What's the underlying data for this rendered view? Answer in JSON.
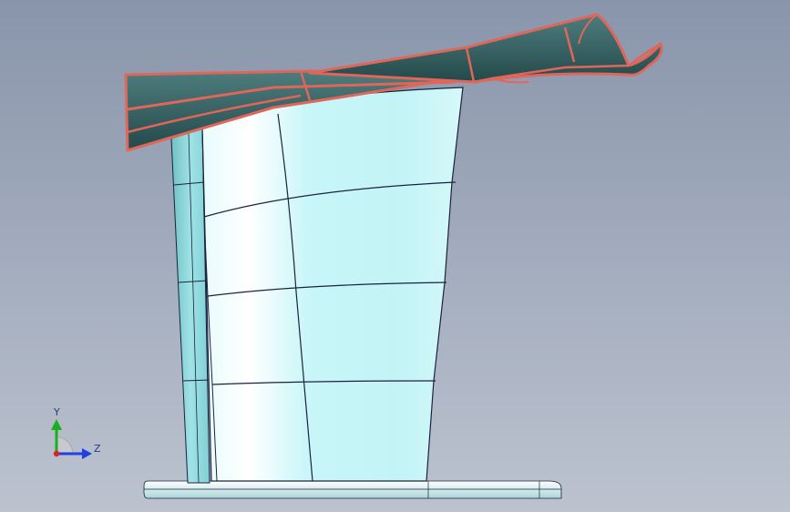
{
  "viewport": {
    "background_top": "#8a97ad",
    "background_bottom": "#b9c1cd",
    "model_face_color": "#bff3f5",
    "model_edge_color": "#1b2240",
    "highlight_edge_color": "#e0665a",
    "roof_fill": "#2f5a5b"
  },
  "triad": {
    "y_label": "Y",
    "z_label": "Z",
    "x_color": "#e02020",
    "y_color": "#18b020",
    "z_color": "#2040e0"
  }
}
